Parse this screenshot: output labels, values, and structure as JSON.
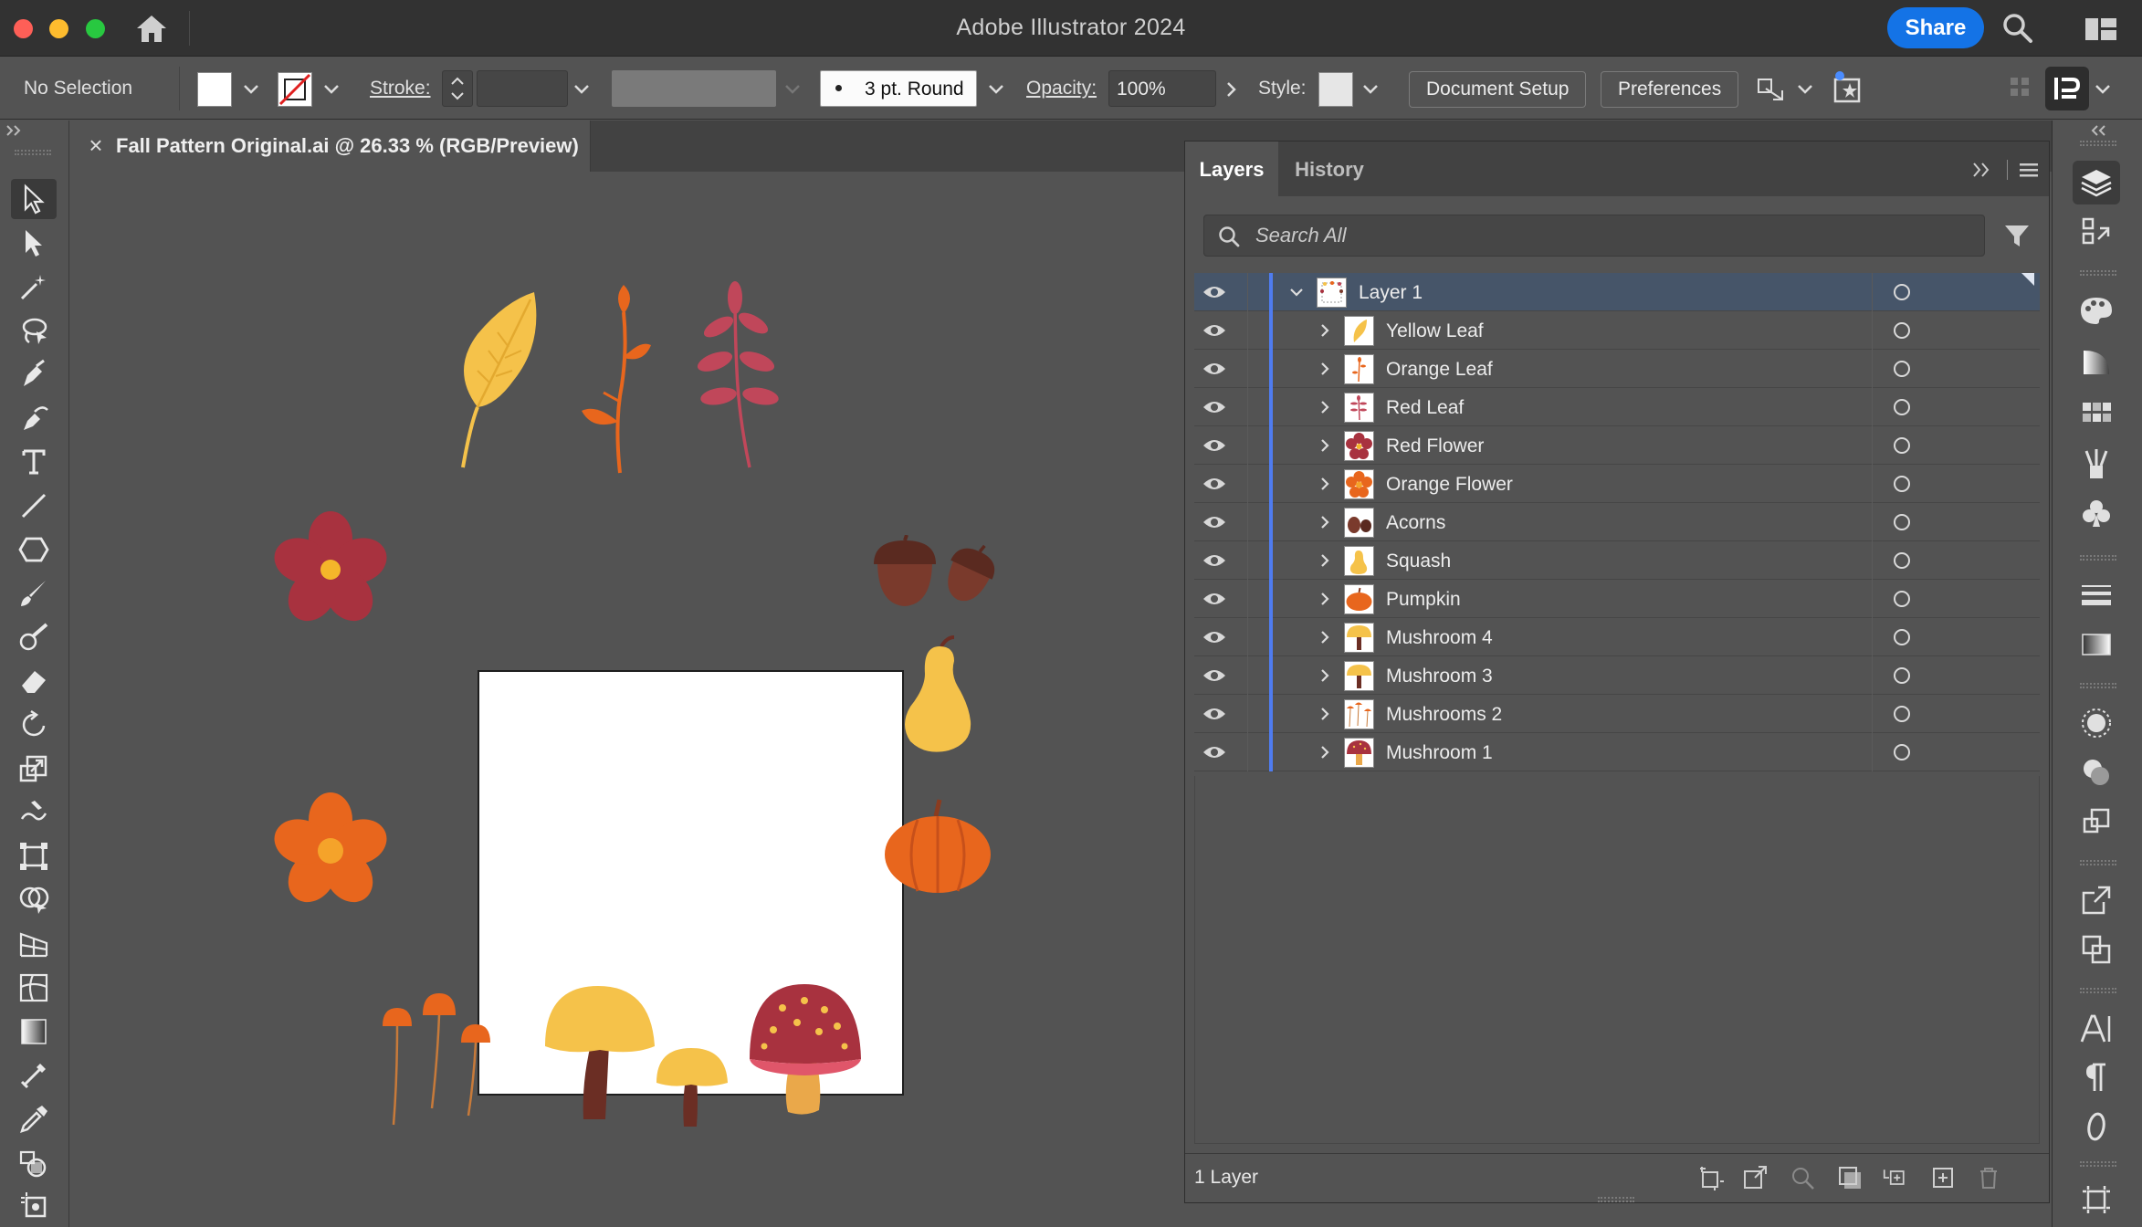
{
  "window": {
    "title": "Adobe Illustrator 2024",
    "share_label": "Share"
  },
  "control_bar": {
    "selection_status": "No Selection",
    "stroke_label": "Stroke:",
    "brush_value": "3 pt. Round",
    "opacity_label": "Opacity:",
    "opacity_value": "100%",
    "style_label": "Style:",
    "document_setup_label": "Document Setup",
    "preferences_label": "Preferences"
  },
  "document": {
    "tab_title": "Fall Pattern Original.ai @ 26.33 % (RGB/Preview)"
  },
  "layers_panel": {
    "tabs": [
      {
        "label": "Layers",
        "active": true
      },
      {
        "label": "History",
        "active": false
      }
    ],
    "search_placeholder": "Search All",
    "parent_layer": "Layer 1",
    "sublayers": [
      "Yellow Leaf",
      "Orange Leaf",
      "Red Leaf",
      "Red Flower",
      "Orange Flower",
      "Acorns",
      "Squash",
      "Pumpkin",
      "Mushroom 4",
      "Mushroom 3",
      "Mushrooms 2",
      "Mushroom 1"
    ],
    "footer_status": "1 Layer"
  },
  "colors": {
    "accent_blue": "#1473e6",
    "layer_color": "#4f7cf0",
    "selected_row": "#465569",
    "yellow": "#f5c24a",
    "orange": "#e8661d",
    "red": "#a8323f",
    "brown": "#6b2e24"
  }
}
